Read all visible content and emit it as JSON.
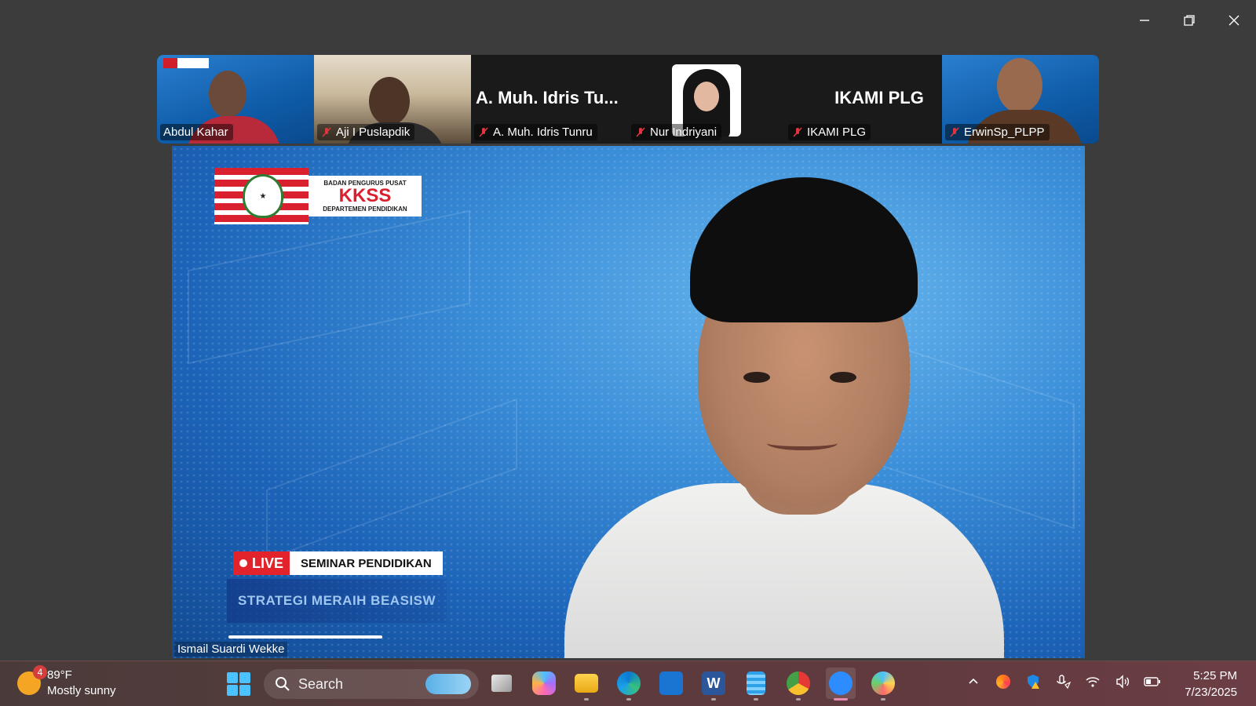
{
  "window": {
    "controls": [
      "minimize-icon",
      "restore-icon",
      "close-icon"
    ]
  },
  "participants": [
    {
      "name": "Abdul Kahar",
      "muted": false
    },
    {
      "name": "Aji I Puslapdik",
      "muted": true
    },
    {
      "name": "A. Muh. Idris Tunru",
      "display_title": "A. Muh. Idris Tu...",
      "muted": true
    },
    {
      "name": "Nur Indriyani",
      "muted": true
    },
    {
      "name": "IKAMI PLG",
      "display_title": "IKAMI PLG",
      "muted": true
    },
    {
      "name": "ErwinSp_PLPP",
      "muted": true
    }
  ],
  "main_video": {
    "speaker_name": "Ismail Suardi Wekke",
    "logo": {
      "line1": "BADAN PENGURUS PUSAT",
      "line2": "KKSS",
      "line3": "DEPARTEMEN PENDIDIKAN"
    },
    "live_label": "LIVE",
    "seminar_label": "SEMINAR PENDIDIKAN",
    "subtitle": "STRATEGI MERAIH BEASISW"
  },
  "taskbar": {
    "weather": {
      "badge": "4",
      "temperature": "89°F",
      "condition": "Mostly sunny"
    },
    "search_placeholder": "Search",
    "apps": [
      "task-view",
      "copilot",
      "file-explorer",
      "edge",
      "vs-code",
      "word",
      "notepad",
      "chrome-beta",
      "zoom",
      "paint"
    ],
    "active_app": "zoom",
    "clock": {
      "time": "5:25 PM",
      "date": "7/23/2025"
    }
  },
  "colors": {
    "accent_red": "#d9202e",
    "zoom_blue": "#2d8cff",
    "taskbar_bg": "#5a3b3c"
  }
}
